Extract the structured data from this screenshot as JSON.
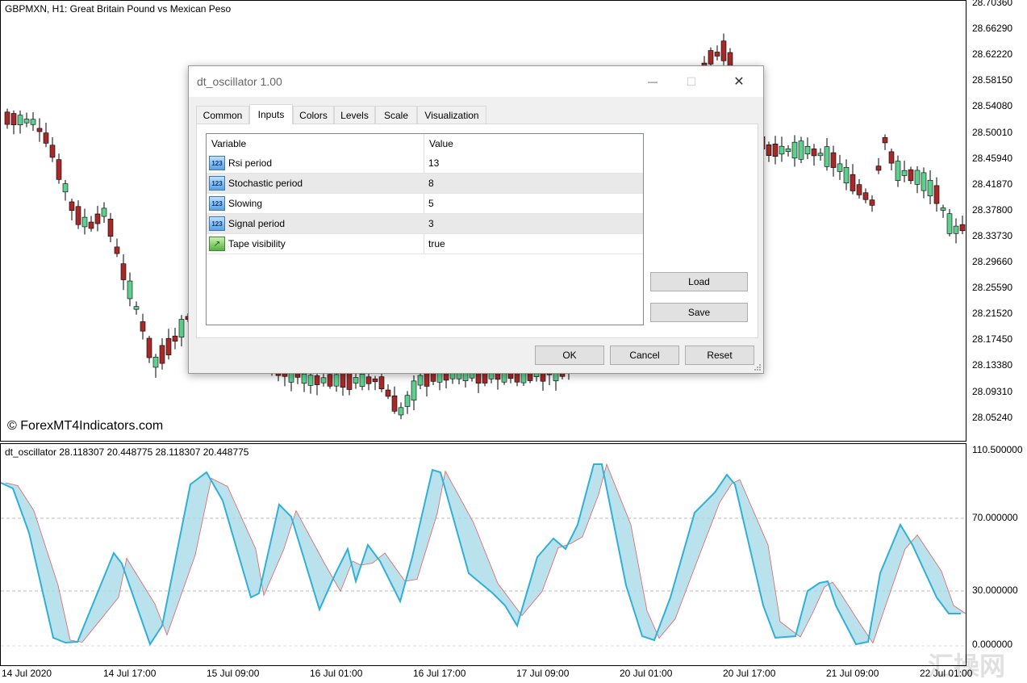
{
  "main_chart": {
    "title": "GBPMXN, H1:  Great Britain Pound vs Mexican Peso",
    "copyright": "© ForexMT4Indicators.com",
    "price_labels": [
      "28.70360",
      "28.66290",
      "28.62220",
      "28.58150",
      "28.54080",
      "28.50010",
      "28.45940",
      "28.41870",
      "28.37800",
      "28.33730",
      "28.29660",
      "28.25590",
      "28.21520",
      "28.17450",
      "28.13380",
      "28.09310",
      "28.05240"
    ],
    "up_color": "#5fcf8f",
    "down_color": "#a52a2a"
  },
  "oscillator": {
    "title": "dt_oscillator 28.118307 20.448775 28.118307 20.448775",
    "levels": [
      "110.500000",
      "70.000000",
      "30.000000",
      "0.000000"
    ],
    "line_color": "#2fb0d8",
    "fill_color": "#a9dbe8",
    "signal_color": "#e06060"
  },
  "time_axis": [
    "14 Jul 2020",
    "14 Jul 17:00",
    "15 Jul 09:00",
    "16 Jul 01:00",
    "16 Jul 17:00",
    "17 Jul 09:00",
    "20 Jul 01:00",
    "20 Jul 17:00",
    "21 Jul 09:00",
    "22 Jul 01:00"
  ],
  "watermark": "汇操网",
  "dialog": {
    "title": "dt_oscillator 1.00",
    "minimize_icon": "—",
    "maximize_icon": "☐",
    "close_icon": "✕",
    "tabs": [
      "Common",
      "Inputs",
      "Colors",
      "Levels",
      "Scale",
      "Visualization"
    ],
    "active_tab": "Inputs",
    "columns": [
      "Variable",
      "Value"
    ],
    "rows": [
      {
        "variable": "Rsi period",
        "value": "13",
        "icon": "123"
      },
      {
        "variable": "Stochastic period",
        "value": "8",
        "icon": "123"
      },
      {
        "variable": "Slowing",
        "value": "5",
        "icon": "123"
      },
      {
        "variable": "Signal period",
        "value": "3",
        "icon": "123"
      },
      {
        "variable": "Tape visibility",
        "value": "true",
        "icon": "bool"
      }
    ],
    "buttons": {
      "load": "Load",
      "save": "Save",
      "ok": "OK",
      "cancel": "Cancel",
      "reset": "Reset"
    }
  }
}
